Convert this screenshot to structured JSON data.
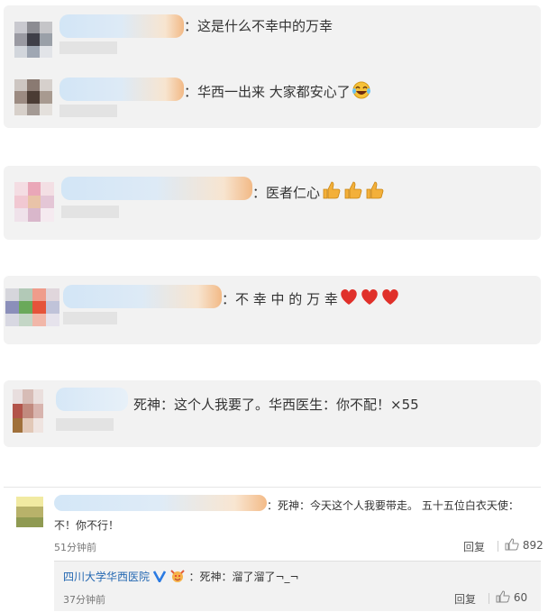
{
  "comments": [
    {
      "text": "：这是什么不幸中的万幸"
    },
    {
      "text": "：华西一出来 大家都安心了",
      "emoji": "laughing-tears-emoji"
    },
    {
      "text": "：医者仁心",
      "emoji": "thumbs-up-emoji-x3"
    },
    {
      "text": "：不 幸 中 的 万 幸",
      "emoji": "heart-emoji-x3"
    },
    {
      "text": "死神：这个人我要了。华西医生：你不配！×55"
    }
  ],
  "featured": {
    "text_line1": "：死神：今天这个人我要带走。 五十五位白衣天使：",
    "text_line2": "不！你不行！",
    "time": "51分钟前",
    "reply_label": "回复",
    "like_count": "892",
    "reply": {
      "author": "四川大学华西医院",
      "text": "：死神：溜了溜了¬_¬",
      "time": "37分钟前",
      "reply_label": "回复",
      "like_count": "60"
    }
  },
  "colors": {
    "link": "#2468b2",
    "verified": "#2a7ae2",
    "heart": "#e0302a",
    "thumb": "#f3b03a"
  }
}
